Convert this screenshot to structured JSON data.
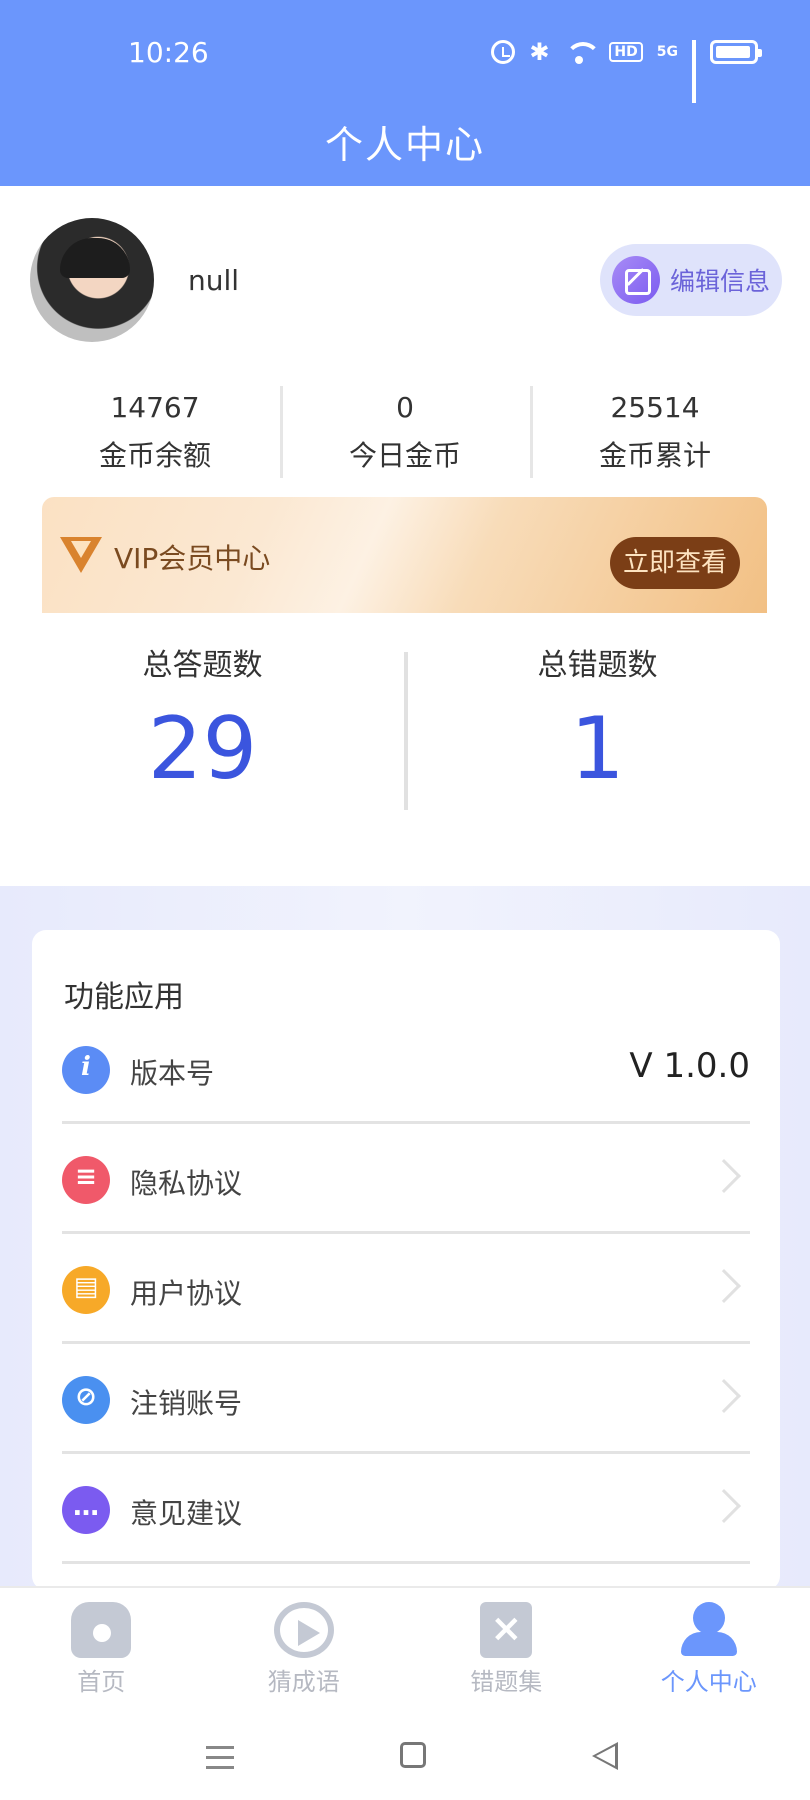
{
  "status_bar": {
    "time": "10:26",
    "hd_label": "HD",
    "net_label": "5G"
  },
  "header": {
    "title": "个人中心"
  },
  "profile": {
    "username": "null",
    "edit_label": "编辑信息"
  },
  "stats": [
    {
      "value": "14767",
      "label": "金币余额"
    },
    {
      "value": "0",
      "label": "今日金币"
    },
    {
      "value": "25514",
      "label": "金币累计"
    }
  ],
  "vip": {
    "label": "VIP会员中心",
    "button": "立即查看"
  },
  "quiz": {
    "total_answered_label": "总答题数",
    "total_answered": "29",
    "total_wrong_label": "总错题数",
    "total_wrong": "1"
  },
  "functions": {
    "title": "功能应用",
    "items": [
      {
        "label": "版本号",
        "value": "V 1.0.0",
        "icon": "info-icon",
        "color": "#5b8cf5"
      },
      {
        "label": "隐私协议",
        "icon": "document-icon",
        "color": "#f0596a"
      },
      {
        "label": "用户协议",
        "icon": "clipboard-icon",
        "color": "#f7a928"
      },
      {
        "label": "注销账号",
        "icon": "account-cancel-icon",
        "color": "#4a90f0"
      },
      {
        "label": "意见建议",
        "icon": "chat-icon",
        "color": "#7b5bf0"
      }
    ]
  },
  "tabs": [
    {
      "label": "首页",
      "icon": "home-icon"
    },
    {
      "label": "猜成语",
      "icon": "play-icon"
    },
    {
      "label": "错题集",
      "icon": "wrong-book-icon"
    },
    {
      "label": "个人中心",
      "icon": "user-icon",
      "active": true
    }
  ],
  "colors": {
    "accent": "#6b96fc",
    "number": "#3b55de",
    "vip_button": "#7b3e16"
  }
}
